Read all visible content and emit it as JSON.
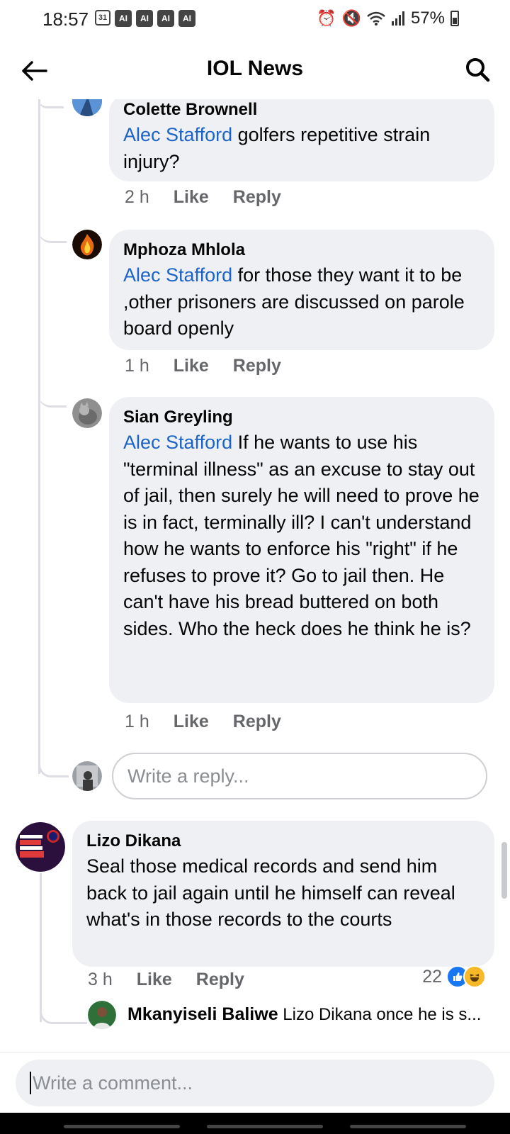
{
  "status_bar": {
    "time": "18:57",
    "calendar_badge": "31",
    "ai_badges": [
      "AI",
      "AI",
      "AI",
      "AI"
    ],
    "battery": "57%"
  },
  "header": {
    "title": "IOL News"
  },
  "replies": [
    {
      "author": "Colette Brownell",
      "mention": "Alec Stafford",
      "text": " golfers repetitive strain injury?",
      "time": "2 h",
      "like": "Like",
      "reply": "Reply"
    },
    {
      "author": "Mphoza Mhlola",
      "mention": "Alec Stafford",
      "text": " for those they want it to be ,other prisoners are discussed on parole board openly",
      "time": "1 h",
      "like": "Like",
      "reply": "Reply"
    },
    {
      "author": "Sian Greyling",
      "mention": "Alec Stafford",
      "text": " If he wants to use his \"terminal illness\" as an excuse to stay out of jail, then surely he will need to prove he is in fact, terminally ill?  I can't understand how he wants to enforce his \"right\" if he refuses to prove it?  Go to jail then. He can't have his bread buttered on both sides. Who the heck does he think he is?",
      "time": "1 h",
      "like": "Like",
      "reply": "Reply"
    }
  ],
  "reply_input": {
    "placeholder": "Write a reply..."
  },
  "main_comment": {
    "author": "Lizo Dikana",
    "text": "Seal those medical records and send him back to jail again until he himself can reveal what's in  those records to the courts",
    "time": "3 h",
    "like": "Like",
    "reply": "Reply",
    "reaction_count": "22"
  },
  "collapsed_reply": {
    "author": "Mkanyiseli Baliwe",
    "preview": "Lizo Dikana once he is s..."
  },
  "comment_input": {
    "placeholder": "Write a comment..."
  }
}
